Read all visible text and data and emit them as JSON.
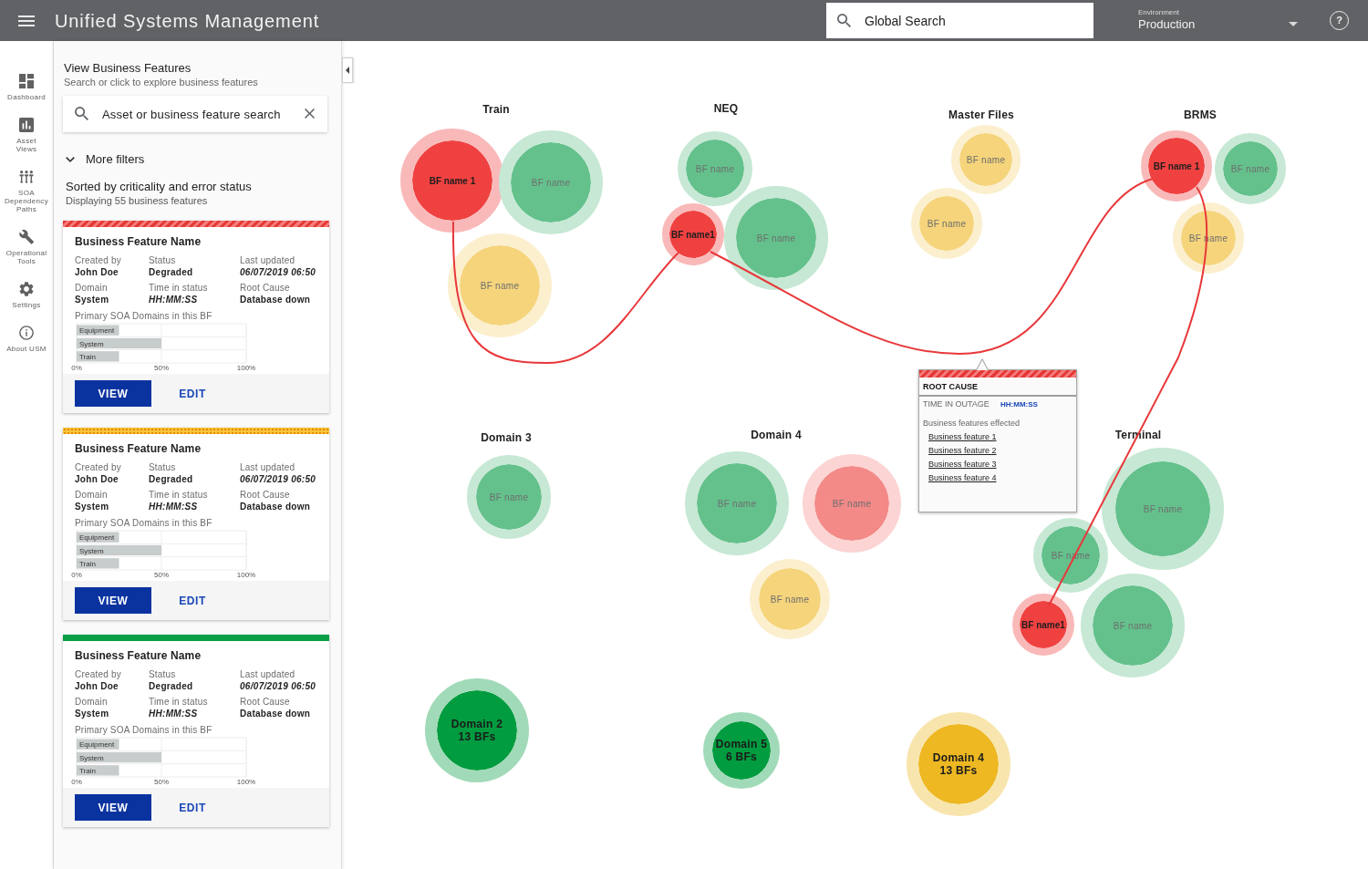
{
  "app_bar": {
    "title": "Unified Systems Management",
    "search": {
      "placeholder": "Global Search"
    },
    "environment": {
      "label": "Environment",
      "value": "Production"
    },
    "help": "?"
  },
  "nav_rail": [
    {
      "label": "Dashboard"
    },
    {
      "label": "Asset\nViews"
    },
    {
      "label": "SOA\nDependency\nPaths"
    },
    {
      "label": "Operational\nTools"
    },
    {
      "label": "Settings"
    },
    {
      "label": "About USM"
    }
  ],
  "panel": {
    "title": "View Business Features",
    "subtitle": "Search or click to explore business features",
    "search": {
      "placeholder": "Asset or business feature search"
    },
    "filters": {
      "label": "More filters",
      "expanded": false
    },
    "sort": {
      "title": "Sorted by criticality and error status",
      "count": "Displaying 55 business features"
    },
    "cards": [
      {
        "kind": "critical",
        "title": "Business Feature Name",
        "fields": [
          {
            "label": "Created by",
            "value": "John Doe",
            "kind": "text"
          },
          {
            "label": "Status",
            "value": "Degraded",
            "kind": "text"
          },
          {
            "label": "Last updated",
            "value": "06/07/2019 06:50",
            "kind": "time"
          },
          {
            "label": "Domain",
            "value": "System",
            "kind": "text"
          },
          {
            "label": "Time in status",
            "value": "HH:MM:SS",
            "kind": "time"
          },
          {
            "label": "Root Cause",
            "value": "Database down",
            "kind": "text"
          }
        ],
        "chart_title": "Primary SOA Domains in this BF",
        "chart_data": {
          "type": "bar",
          "orientation": "horizontal",
          "categories": [
            "Equipment",
            "System",
            "Train"
          ],
          "values": [
            25,
            50,
            25
          ],
          "xlim": [
            0,
            100
          ],
          "xticks": [
            {
              "value": 0,
              "label": "0%"
            },
            {
              "value": 50,
              "label": "50%"
            },
            {
              "value": 100,
              "label": "100%"
            }
          ]
        },
        "actions": [
          {
            "label": "VIEW",
            "kind": "primary"
          },
          {
            "label": "EDIT",
            "kind": "text"
          }
        ]
      },
      {
        "kind": "warning",
        "title": "Business Feature Name",
        "fields": [
          {
            "label": "Created by",
            "value": "John Doe",
            "kind": "text"
          },
          {
            "label": "Status",
            "value": "Degraded",
            "kind": "text"
          },
          {
            "label": "Last updated",
            "value": "06/07/2019 06:50",
            "kind": "time"
          },
          {
            "label": "Domain",
            "value": "System",
            "kind": "text"
          },
          {
            "label": "Time in status",
            "value": "HH:MM:SS",
            "kind": "time"
          },
          {
            "label": "Root Cause",
            "value": "Database down",
            "kind": "text"
          }
        ],
        "chart_title": "Primary SOA Domains in this BF",
        "chart_data": {
          "type": "bar",
          "orientation": "horizontal",
          "categories": [
            "Equipment",
            "System",
            "Train"
          ],
          "values": [
            25,
            50,
            25
          ],
          "xlim": [
            0,
            100
          ],
          "xticks": [
            {
              "value": 0,
              "label": "0%"
            },
            {
              "value": 50,
              "label": "50%"
            },
            {
              "value": 100,
              "label": "100%"
            }
          ]
        },
        "actions": [
          {
            "label": "VIEW",
            "kind": "primary"
          },
          {
            "label": "EDIT",
            "kind": "text"
          }
        ]
      },
      {
        "kind": "healthy",
        "title": "Business Feature Name",
        "fields": [
          {
            "label": "Created by",
            "value": "John Doe",
            "kind": "text"
          },
          {
            "label": "Status",
            "value": "Degraded",
            "kind": "text"
          },
          {
            "label": "Last updated",
            "value": "06/07/2019 06:50",
            "kind": "time"
          },
          {
            "label": "Domain",
            "value": "System",
            "kind": "text"
          },
          {
            "label": "Time in status",
            "value": "HH:MM:SS",
            "kind": "time"
          },
          {
            "label": "Root Cause",
            "value": "Database down",
            "kind": "text"
          }
        ],
        "chart_title": "Primary SOA Domains in this BF",
        "chart_data": {
          "type": "bar",
          "orientation": "horizontal",
          "categories": [
            "Equipment",
            "System",
            "Train"
          ],
          "values": [
            25,
            50,
            25
          ],
          "xlim": [
            0,
            100
          ],
          "xticks": [
            {
              "value": 0,
              "label": "0%"
            },
            {
              "value": 50,
              "label": "50%"
            },
            {
              "value": 100,
              "label": "100%"
            }
          ]
        },
        "actions": [
          {
            "label": "VIEW",
            "kind": "primary"
          },
          {
            "label": "EDIT",
            "kind": "text"
          }
        ]
      }
    ]
  },
  "canvas": {
    "groups": [
      {
        "title": "Train",
        "bubbles": [
          {
            "label": "BF name 1",
            "color": "#f04141",
            "highlighted": true
          },
          {
            "label": "BF name",
            "color": "#64c18c",
            "highlighted": false
          },
          {
            "label": "BF name",
            "color": "#f5d47b",
            "highlighted": false
          }
        ]
      },
      {
        "title": "NEQ",
        "bubbles": [
          {
            "label": "BF name",
            "color": "#64c18c",
            "highlighted": false
          },
          {
            "label": "BF name1",
            "color": "#f04141",
            "highlighted": true
          },
          {
            "label": "BF name",
            "color": "#64c18c",
            "highlighted": false
          }
        ]
      },
      {
        "title": "Master Files",
        "bubbles": [
          {
            "label": "BF name",
            "color": "#f5d47b",
            "highlighted": false
          },
          {
            "label": "BF name",
            "color": "#f5d47b",
            "highlighted": false
          }
        ]
      },
      {
        "title": "BRMS",
        "bubbles": [
          {
            "label": "BF name 1",
            "color": "#f04141",
            "highlighted": true
          },
          {
            "label": "BF name",
            "color": "#64c18c",
            "highlighted": false
          },
          {
            "label": "BF name",
            "color": "#f5d47b",
            "highlighted": false
          }
        ]
      },
      {
        "title": "Domain 3",
        "bubbles": [
          {
            "label": "BF name",
            "color": "#64c18c",
            "highlighted": false
          }
        ]
      },
      {
        "title": "Domain 4",
        "bubbles": [
          {
            "label": "BF name",
            "color": "#64c18c",
            "highlighted": false
          },
          {
            "label": "BF name",
            "color": "#f38a88",
            "highlighted": false
          },
          {
            "label": "BF name",
            "color": "#f5d47b",
            "highlighted": false
          }
        ]
      },
      {
        "title": "Terminal",
        "bubbles": [
          {
            "label": "BF name",
            "color": "#64c18c",
            "highlighted": false
          },
          {
            "label": "BF name",
            "color": "#64c18c",
            "highlighted": false
          },
          {
            "label": "BF name1",
            "color": "#f04141",
            "highlighted": true
          },
          {
            "label": "BF name",
            "color": "#64c18c",
            "highlighted": false
          }
        ]
      }
    ],
    "domain_summaries": [
      {
        "name": "Domain 2",
        "count": "13 BFs",
        "color": "#009c3f"
      },
      {
        "name": "Domain 5",
        "count": "6 BFs",
        "color": "#009c3f"
      },
      {
        "name": "Domain 4",
        "count": "13 BFs",
        "color": "#edb822"
      }
    ],
    "root_cause_popup": {
      "title": "ROOT CAUSE",
      "time_label": "TIME IN OUTAGE",
      "time_value": "HH:MM:SS",
      "affected_label": "Business features effected",
      "links": [
        "Business feature 1",
        "Business feature 2",
        "Business feature 3",
        "Business feature 4"
      ]
    }
  }
}
